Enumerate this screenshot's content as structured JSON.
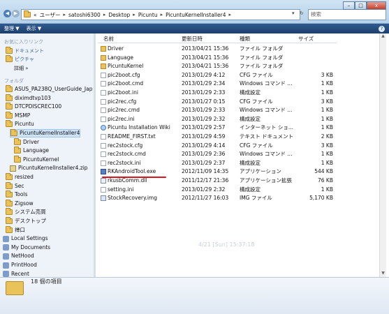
{
  "address": {
    "crumbs": [
      "«",
      "ユーザー",
      "satoshi6300",
      "Desktop",
      "Picuntu",
      "PicuntuKernelInstaller4"
    ],
    "dropdown_icon": "chevron-down-icon",
    "refresh_icon": "refresh-icon"
  },
  "search": {
    "placeholder": "検索"
  },
  "window_controls": {
    "minimize": "–",
    "maximize": "□",
    "close": "x"
  },
  "toolbar": {
    "organize": "整理 ▼",
    "view": "表示 ▼",
    "help": "?"
  },
  "nav_pane": {
    "favorites_header": "お気に入りリンク",
    "favorites": [
      {
        "label": "ドキュメント",
        "icon": "document-icon"
      },
      {
        "label": "ピクチャ",
        "icon": "picture-icon"
      },
      {
        "label": "詳細 »",
        "icon": ""
      }
    ],
    "folders_header": "フォルダ",
    "tree": [
      {
        "label": "ASUS_PA238Q_UserGuide_Jap",
        "type": "folder"
      },
      {
        "label": "diximdtvp103",
        "type": "folder"
      },
      {
        "label": "DTCPDISCREC100",
        "type": "folder"
      },
      {
        "label": "MSMP",
        "type": "folder"
      },
      {
        "label": "Picuntu",
        "type": "folder"
      },
      {
        "label": "PicuntuKernelInstaller4",
        "type": "folder",
        "selected": true
      },
      {
        "label": "Driver",
        "type": "folder"
      },
      {
        "label": "Language",
        "type": "folder"
      },
      {
        "label": "PicuntuKernel",
        "type": "folder"
      },
      {
        "label": "PicuntuKernelInstaller4.zip",
        "type": "zip"
      },
      {
        "label": "resized",
        "type": "folder"
      },
      {
        "label": "Sec",
        "type": "folder"
      },
      {
        "label": "Tools",
        "type": "folder"
      },
      {
        "label": "Zigsow",
        "type": "folder"
      },
      {
        "label": "システム売買",
        "type": "folder"
      },
      {
        "label": "デスクトップ",
        "type": "folder"
      },
      {
        "label": "禅口",
        "type": "folder"
      },
      {
        "label": "Local Settings",
        "type": "special"
      },
      {
        "label": "My Documents",
        "type": "special"
      },
      {
        "label": "NetHood",
        "type": "special"
      },
      {
        "label": "PrintHood",
        "type": "special"
      },
      {
        "label": "Recent",
        "type": "special"
      }
    ]
  },
  "columns": {
    "name": "名前",
    "date": "更新日時",
    "type": "種類",
    "size": "サイズ"
  },
  "files": [
    {
      "name": "Driver",
      "date": "2013/04/21 15:36",
      "type": "ファイル フォルダ",
      "size": "",
      "icon": "folder"
    },
    {
      "name": "Language",
      "date": "2013/04/21 15:36",
      "type": "ファイル フォルダ",
      "size": "",
      "icon": "folder"
    },
    {
      "name": "PicuntuKernel",
      "date": "2013/04/21 15:36",
      "type": "ファイル フォルダ",
      "size": "",
      "icon": "folder"
    },
    {
      "name": "pic2boot.cfg",
      "date": "2013/01/29 4:12",
      "type": "CFG ファイル",
      "size": "3 KB",
      "icon": "file"
    },
    {
      "name": "pic2boot.cmd",
      "date": "2013/01/29 2:34",
      "type": "Windows コマンド ...",
      "size": "1 KB",
      "icon": "file"
    },
    {
      "name": "pic2boot.ini",
      "date": "2013/01/29 2:33",
      "type": "構成設定",
      "size": "1 KB",
      "icon": "file"
    },
    {
      "name": "pic2rec.cfg",
      "date": "2013/01/27 0:15",
      "type": "CFG ファイル",
      "size": "3 KB",
      "icon": "file"
    },
    {
      "name": "pic2rec.cmd",
      "date": "2013/01/29 2:33",
      "type": "Windows コマンド ...",
      "size": "1 KB",
      "icon": "file"
    },
    {
      "name": "pic2rec.ini",
      "date": "2013/01/29 2:32",
      "type": "構成設定",
      "size": "1 KB",
      "icon": "file"
    },
    {
      "name": "Picuntu Installation Wiki",
      "date": "2013/01/29 2:57",
      "type": "インターネット ショ...",
      "size": "1 KB",
      "icon": "web"
    },
    {
      "name": "README_FIRST.txt",
      "date": "2013/01/29 4:59",
      "type": "テキスト ドキュメント",
      "size": "2 KB",
      "icon": "file"
    },
    {
      "name": "rec2stock.cfg",
      "date": "2013/01/29 4:14",
      "type": "CFG ファイル",
      "size": "3 KB",
      "icon": "file"
    },
    {
      "name": "rec2stock.cmd",
      "date": "2013/01/29 2:36",
      "type": "Windows コマンド ...",
      "size": "1 KB",
      "icon": "file"
    },
    {
      "name": "rec2stock.ini",
      "date": "2013/01/29 2:37",
      "type": "構成設定",
      "size": "1 KB",
      "icon": "file"
    },
    {
      "name": "RKAndroidTool.exe",
      "date": "2012/11/09 14:35",
      "type": "アプリケーション",
      "size": "544 KB",
      "icon": "exe"
    },
    {
      "name": "rkusbComm.dll",
      "date": "2011/12/17 21:36",
      "type": "アプリケーション拡張",
      "size": "76 KB",
      "icon": "dll"
    },
    {
      "name": "setting.ini",
      "date": "2013/01/29 2:32",
      "type": "構成設定",
      "size": "1 KB",
      "icon": "file"
    },
    {
      "name": "StockRecovery.img",
      "date": "2012/11/27 16:03",
      "type": "IMG ファイル",
      "size": "5,170 KB",
      "icon": "img"
    }
  ],
  "watermark": "4/21 [Sun] 15:37:18",
  "status": {
    "item_count": "18 個の項目"
  },
  "colors": {
    "toolbar": "#1e3f6b",
    "selection": "#cde3f8",
    "annotation": "#d9141a",
    "folder": "#e9c25a"
  }
}
